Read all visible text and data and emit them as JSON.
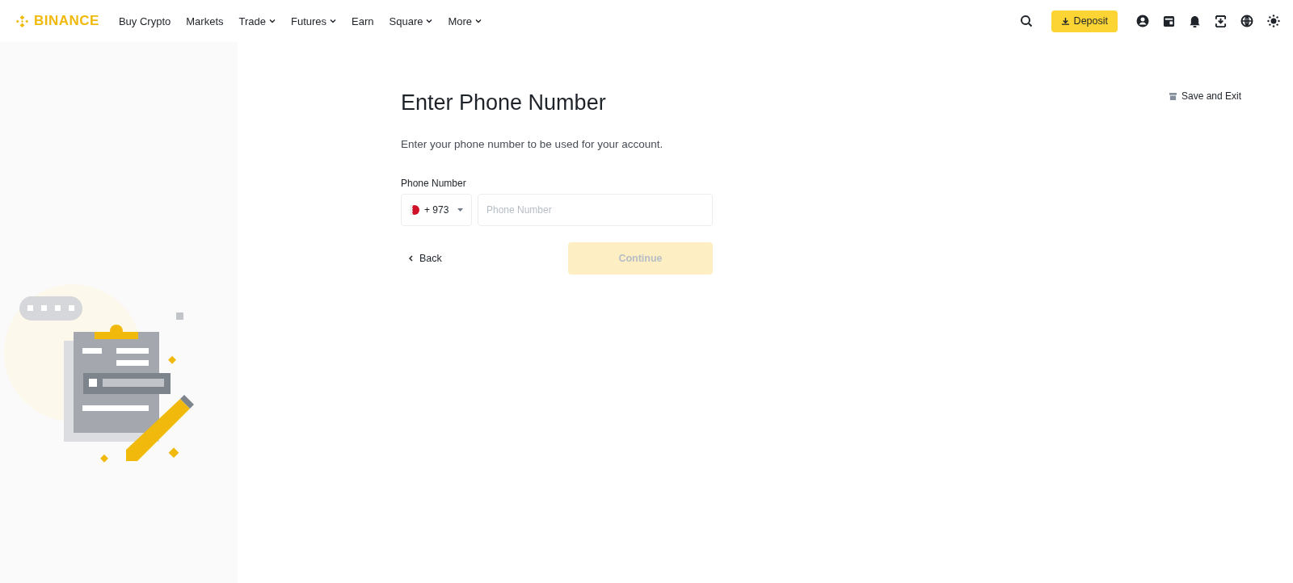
{
  "header": {
    "logo": "BINANCE",
    "nav": [
      {
        "label": "Buy Crypto",
        "has_menu": false
      },
      {
        "label": "Markets",
        "has_menu": false
      },
      {
        "label": "Trade",
        "has_menu": true
      },
      {
        "label": "Futures",
        "has_menu": true
      },
      {
        "label": "Earn",
        "has_menu": false
      },
      {
        "label": "Square",
        "has_menu": true
      },
      {
        "label": "More",
        "has_menu": true
      }
    ],
    "deposit": "Deposit"
  },
  "save_exit": "Save and Exit",
  "form": {
    "title": "Enter Phone Number",
    "subtitle": "Enter your phone number to be used for your account.",
    "field_label": "Phone Number",
    "country_code": "+ 973",
    "phone": {
      "placeholder": "Phone Number"
    },
    "back": "Back",
    "continue": {
      "label": "Continue",
      "disabled": true
    }
  }
}
